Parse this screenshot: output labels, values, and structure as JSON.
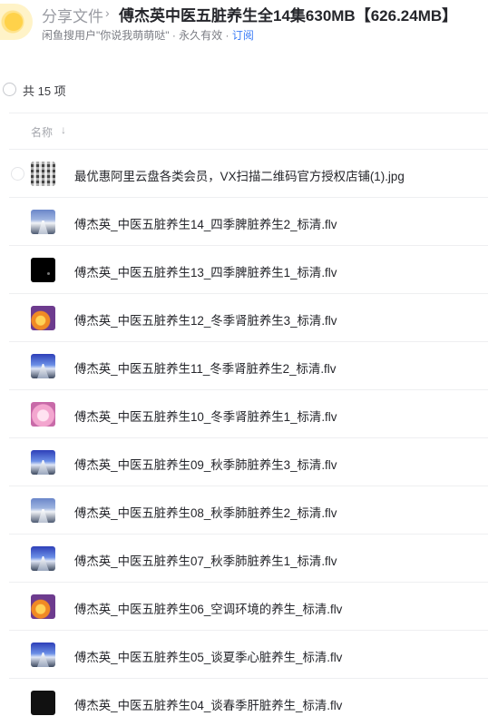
{
  "header": {
    "breadcrumb_root": "分享文件",
    "breadcrumb_separator": "›",
    "title": "傅杰英中医五脏养生全14集630MB【626.24MB】",
    "meta_text": "闲鱼搜用户\"你说我萌萌哒\" · 永久有效 · ",
    "subscribe_label": "订阅"
  },
  "list": {
    "count_text": "共 15 项",
    "column_name": "名称",
    "sort_icon": "arrow-down-icon",
    "files": [
      {
        "name": "最优惠阿里云盘各类会员，VX扫描二维码官方授权店铺(1).jpg",
        "thumb": "qr-thumbnail"
      },
      {
        "name": "傅杰英_中医五脏养生14_四季脾脏养生2_标清.flv",
        "thumb": "road-thumbnail"
      },
      {
        "name": "傅杰英_中医五脏养生13_四季脾脏养生1_标清.flv",
        "thumb": "black-thumbnail"
      },
      {
        "name": "傅杰英_中医五脏养生12_冬季肾脏养生3_标清.flv",
        "thumb": "fire-thumbnail"
      },
      {
        "name": "傅杰英_中医五脏养生11_冬季肾脏养生2_标清.flv",
        "thumb": "sky-thumbnail"
      },
      {
        "name": "傅杰英_中医五脏养生10_冬季肾脏养生1_标清.flv",
        "thumb": "pink-thumbnail"
      },
      {
        "name": "傅杰英_中医五脏养生09_秋季肺脏养生3_标清.flv",
        "thumb": "sky-thumbnail"
      },
      {
        "name": "傅杰英_中医五脏养生08_秋季肺脏养生2_标清.flv",
        "thumb": "road-thumbnail"
      },
      {
        "name": "傅杰英_中医五脏养生07_秋季肺脏养生1_标清.flv",
        "thumb": "sky-thumbnail"
      },
      {
        "name": "傅杰英_中医五脏养生06_空调环境的养生_标清.flv",
        "thumb": "fire-thumbnail"
      },
      {
        "name": "傅杰英_中医五脏养生05_谈夏季心脏养生_标清.flv",
        "thumb": "sky-thumbnail"
      },
      {
        "name": "傅杰英_中医五脏养生04_谈春季肝脏养生_标清.flv",
        "thumb": "dark-thumbnail"
      }
    ]
  }
}
